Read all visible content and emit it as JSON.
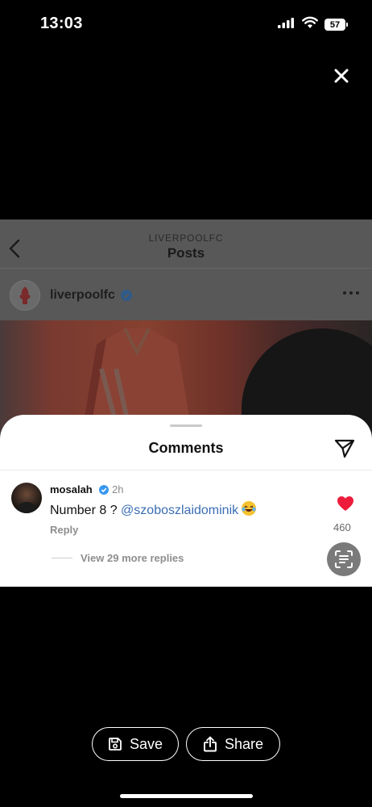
{
  "status_bar": {
    "time": "13:03",
    "battery": "57"
  },
  "preview": {
    "account_label": "LIVERPOOLFC",
    "page_title": "Posts",
    "post_username": "liverpoolfc"
  },
  "comments": {
    "title": "Comments",
    "comment": {
      "username": "mosalah",
      "time": "2h",
      "text_prefix": "Number 8 ? ",
      "mention": "@szoboszlaidominik",
      "reply_label": "Reply",
      "like_count": "460",
      "view_replies": "View 29 more replies"
    }
  },
  "actions": {
    "save_label": "Save",
    "share_label": "Share"
  },
  "colors": {
    "verified": "#3897f0",
    "like": "#ed1c3b",
    "mention": "#3b6db4"
  }
}
